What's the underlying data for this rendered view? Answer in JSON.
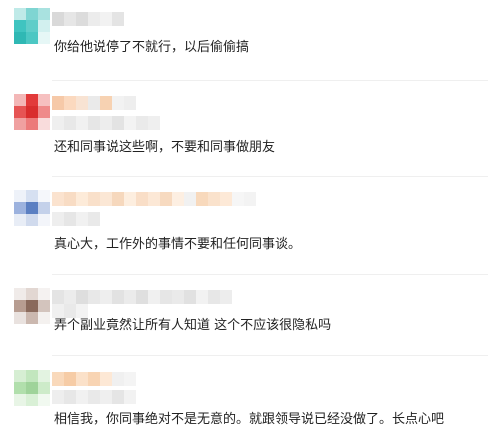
{
  "comments": [
    {
      "text": "你给他说停了不就行，以后偷偷搞",
      "colors": {
        "accent": "#3fc4c0",
        "light": "#b7e8e6",
        "mid": "#7fd5d2"
      }
    },
    {
      "text": "还和同事说这些啊，不要和同事做朋友",
      "colors": {
        "accent": "#e23a3a",
        "light": "#f6c0c0",
        "mid": "#ec7a7a"
      }
    },
    {
      "text": "真心大，工作外的事情不要和任何同事谈。",
      "colors": {
        "accent": "#5b7fc2",
        "light": "#d6e0f1",
        "mid": "#9cb2de"
      }
    },
    {
      "text": "弄个副业竟然让所有人知道 这个不应该很隐私吗",
      "colors": {
        "accent": "#8a6a5c",
        "light": "#e2d7d2",
        "mid": "#b79d91"
      }
    },
    {
      "text": "相信我，你同事绝对不是无意的。就跟领导说已经没做了。长点心吧",
      "colors": {
        "accent": "#9fd39a",
        "light": "#e3f3e1",
        "mid": "#c2e6be"
      }
    }
  ]
}
